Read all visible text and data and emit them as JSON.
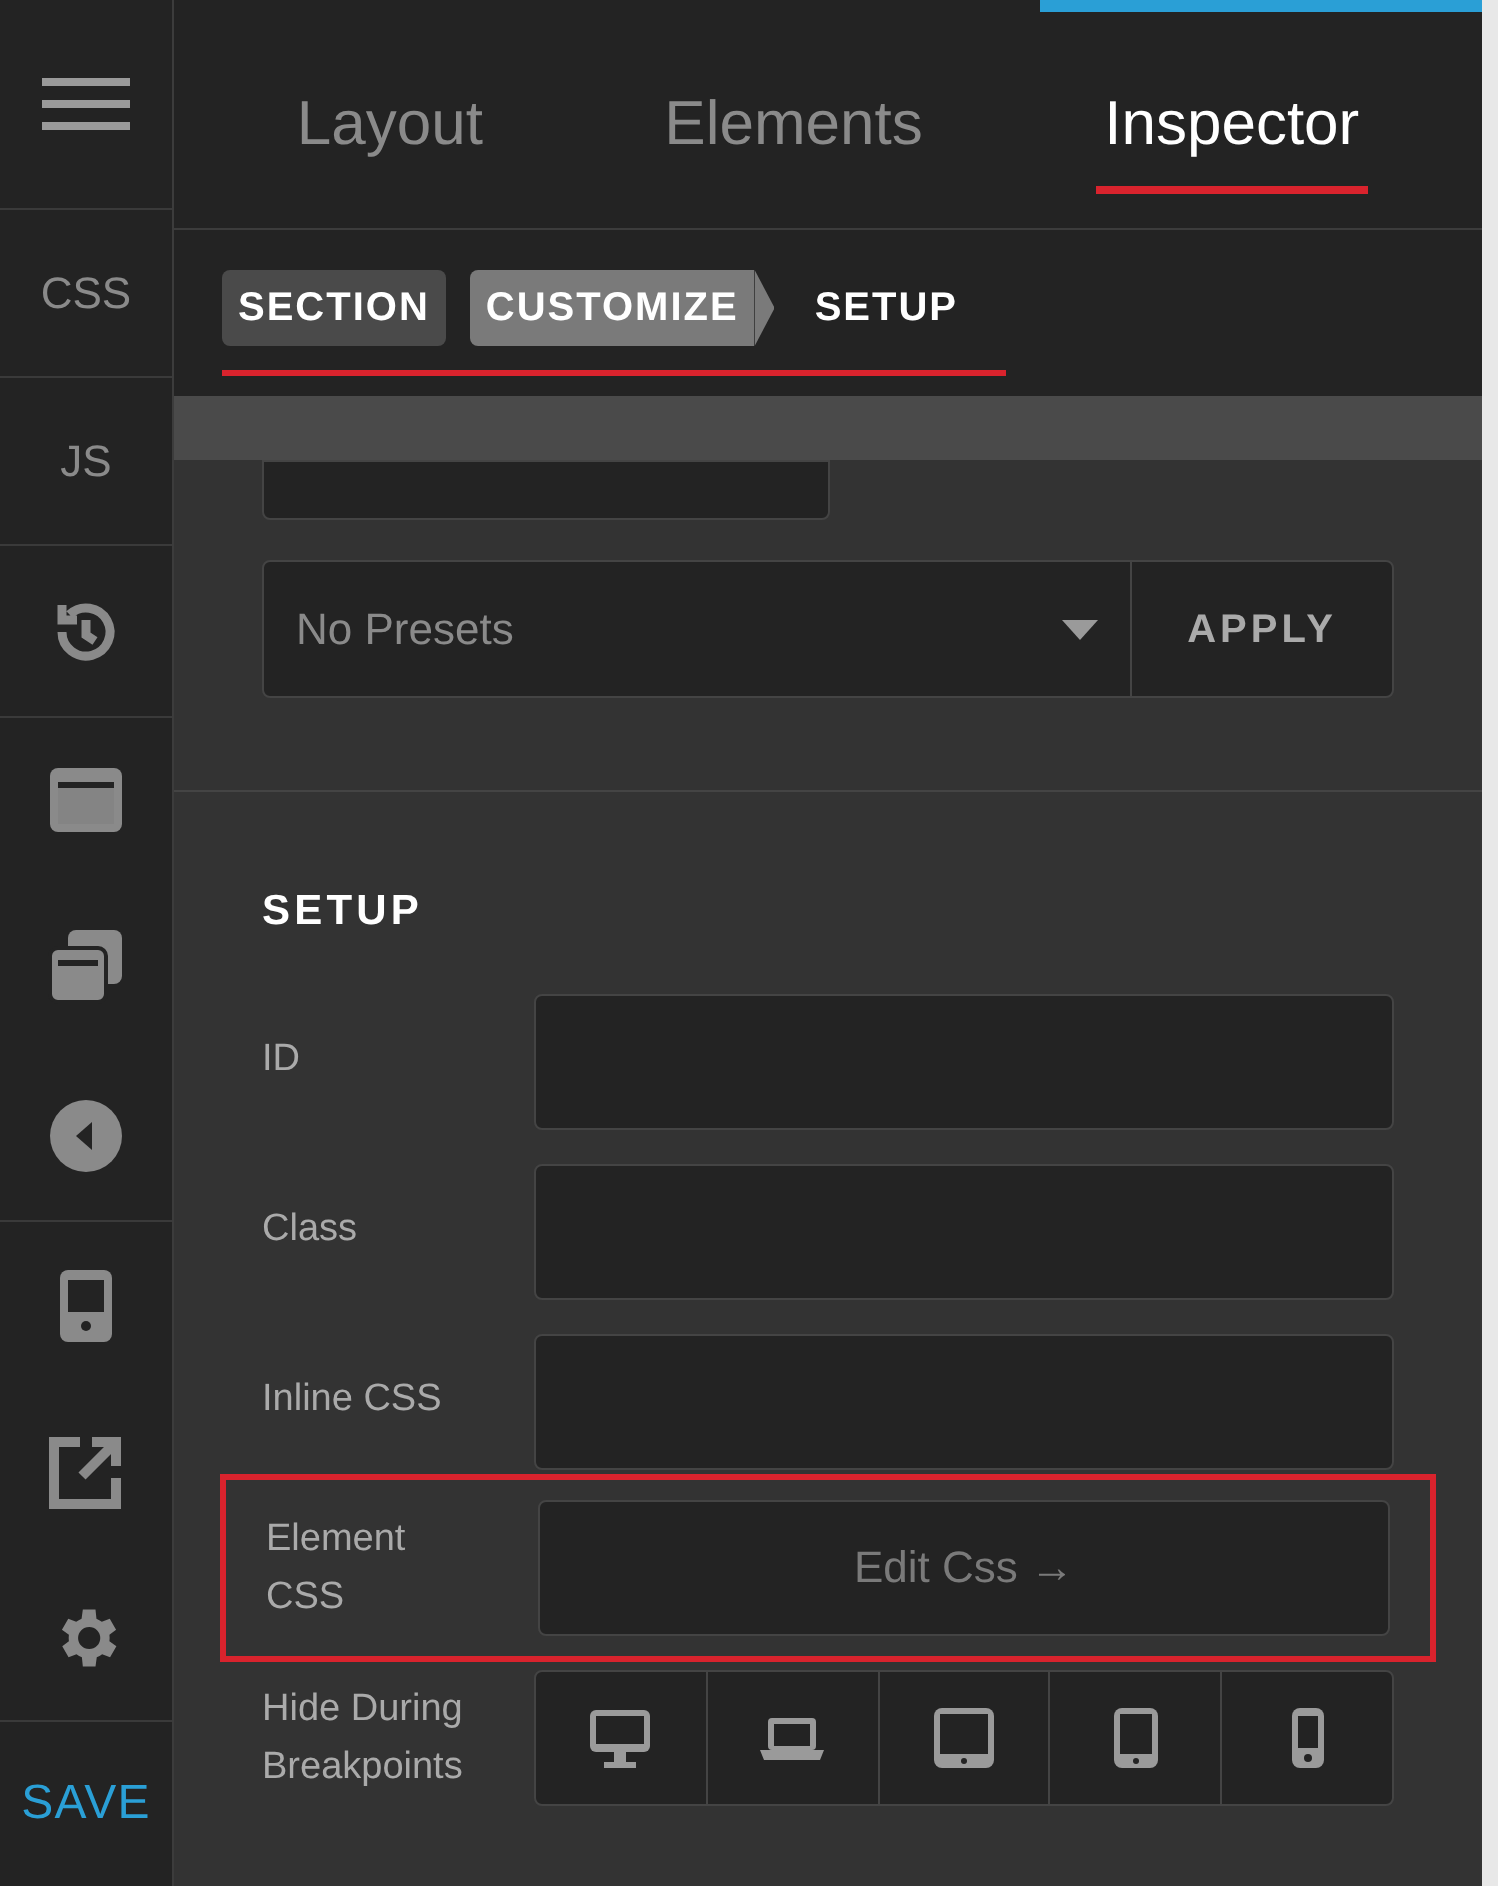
{
  "sidebar": {
    "items": [
      {
        "kind": "menu"
      },
      {
        "kind": "text",
        "label": "CSS"
      },
      {
        "kind": "text",
        "label": "JS"
      },
      {
        "kind": "history"
      },
      {
        "kind": "panel"
      },
      {
        "kind": "layers"
      },
      {
        "kind": "back"
      },
      {
        "kind": "device"
      },
      {
        "kind": "external"
      },
      {
        "kind": "settings"
      },
      {
        "kind": "save",
        "label": "SAVE"
      }
    ]
  },
  "tabs": [
    {
      "label": "Layout",
      "selected": false
    },
    {
      "label": "Elements",
      "selected": false
    },
    {
      "label": "Inspector",
      "selected": true
    }
  ],
  "breadcrumbs": [
    {
      "label": "SECTION",
      "selected": false
    },
    {
      "label": "CUSTOMIZE",
      "selected": false
    },
    {
      "label": "SETUP",
      "selected": true
    }
  ],
  "presets": {
    "placeholder": "No Presets",
    "apply": "APPLY"
  },
  "setup": {
    "title": "SETUP",
    "fields": [
      {
        "label": "ID"
      },
      {
        "label": "Class"
      },
      {
        "label": "Inline CSS"
      }
    ],
    "element_css": {
      "label": "Element CSS",
      "button": "Edit Css →",
      "highlighted": true
    },
    "breakpoints": {
      "label": "Hide During Breakpoints",
      "devices": [
        {
          "kind": "desktop"
        },
        {
          "kind": "laptop"
        },
        {
          "kind": "tablet-landscape"
        },
        {
          "kind": "tablet"
        },
        {
          "kind": "phone"
        }
      ]
    }
  }
}
